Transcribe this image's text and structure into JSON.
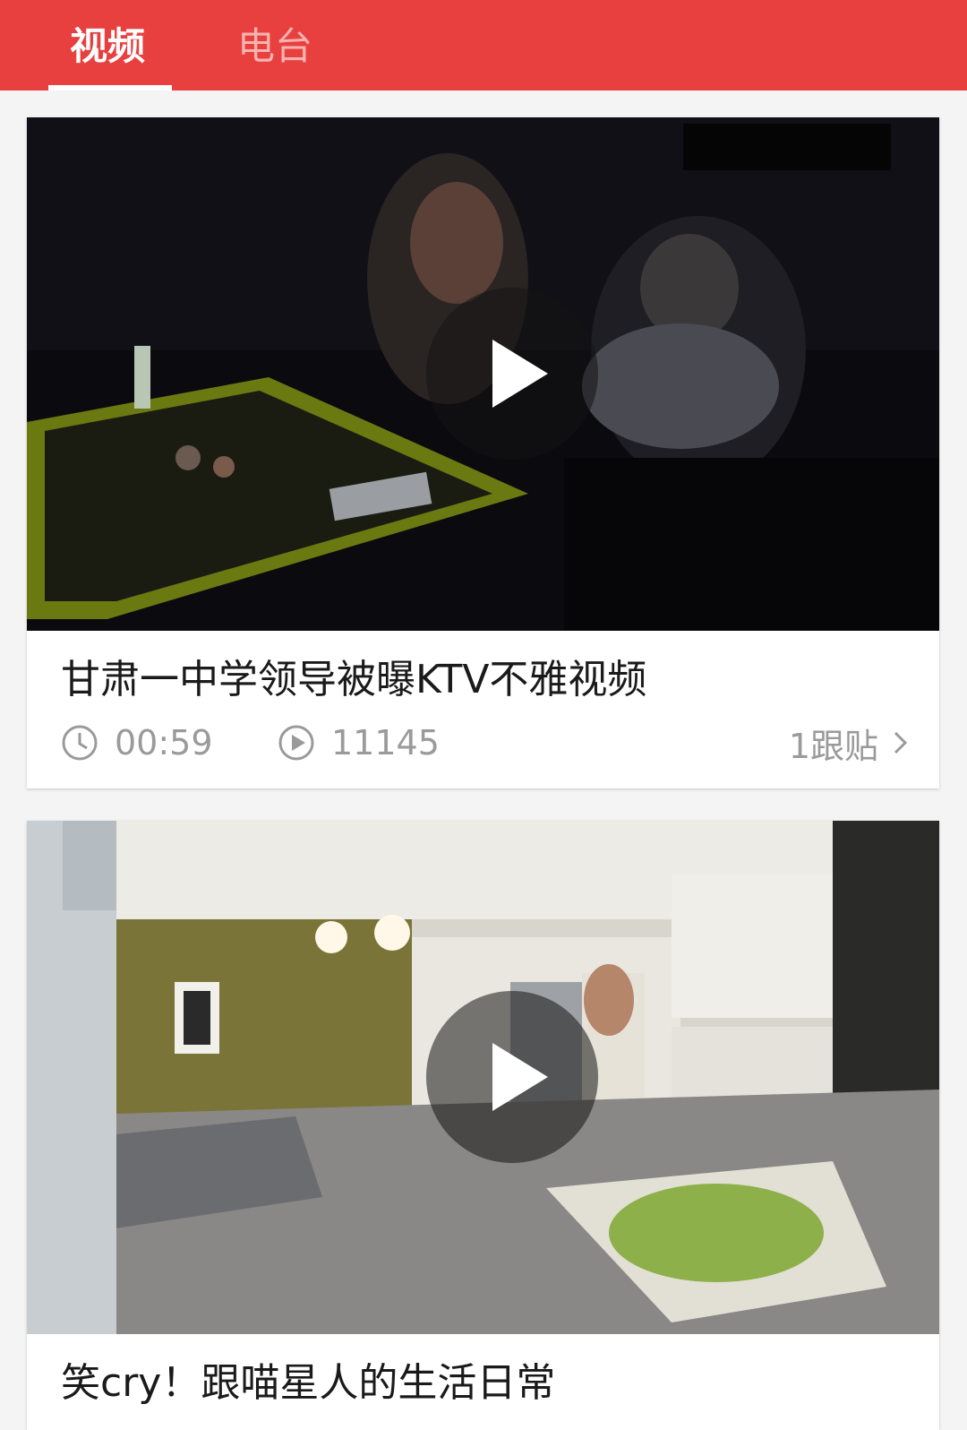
{
  "tabs": [
    {
      "label": "视频",
      "active": true
    },
    {
      "label": "电台",
      "active": false
    }
  ],
  "colors": {
    "accent": "#e8403f",
    "meta": "#9a9a9a"
  },
  "videos": [
    {
      "title": "甘肃一中学领导被曝KTV不雅视频",
      "duration": "00:59",
      "plays": "11145",
      "comments": "1跟贴",
      "icons": [
        "clock-icon",
        "play-count-icon",
        "chevron-right-icon"
      ]
    },
    {
      "title": "笑cry！跟喵星人的生活日常"
    }
  ]
}
